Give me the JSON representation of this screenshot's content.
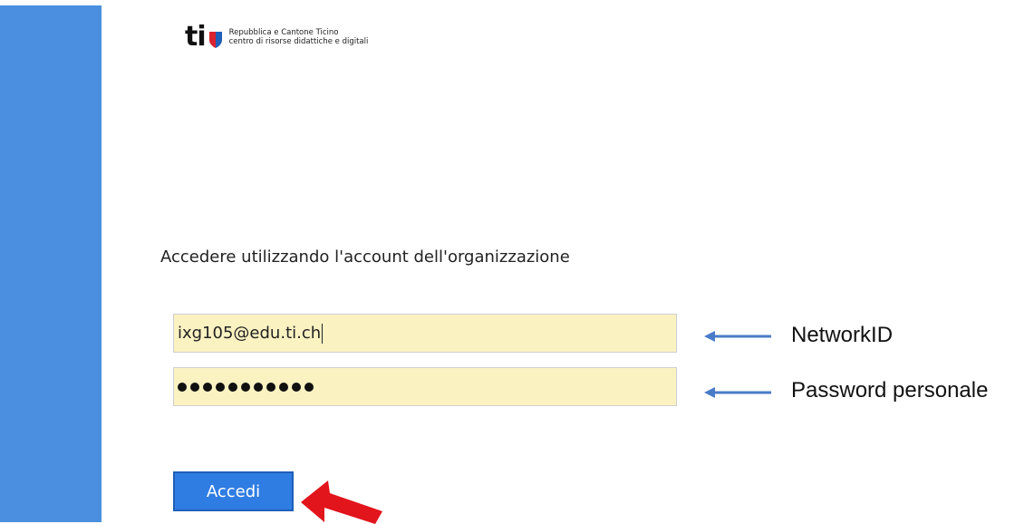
{
  "logo": {
    "mark": "ti",
    "line1": "Repubblica e Cantone Ticino",
    "line2": "centro di risorse didattiche e digitali",
    "shield_colors": {
      "left": "#1f5fb8",
      "right": "#d9232e"
    }
  },
  "form": {
    "heading": "Accedere utilizzando l'account dell'organizzazione",
    "username_value": "ixg105@edu.ti.ch",
    "password_mask_count": 11,
    "submit_label": "Accedi"
  },
  "annotations": {
    "username_label": "NetworkID",
    "password_label": "Password personale"
  },
  "colors": {
    "sidebar": "#4a8fe0",
    "field_bg": "#fbf2c2",
    "button": "#2f7de3",
    "arrow_blue": "#4a7bc8",
    "arrow_red": "#e2141c"
  }
}
